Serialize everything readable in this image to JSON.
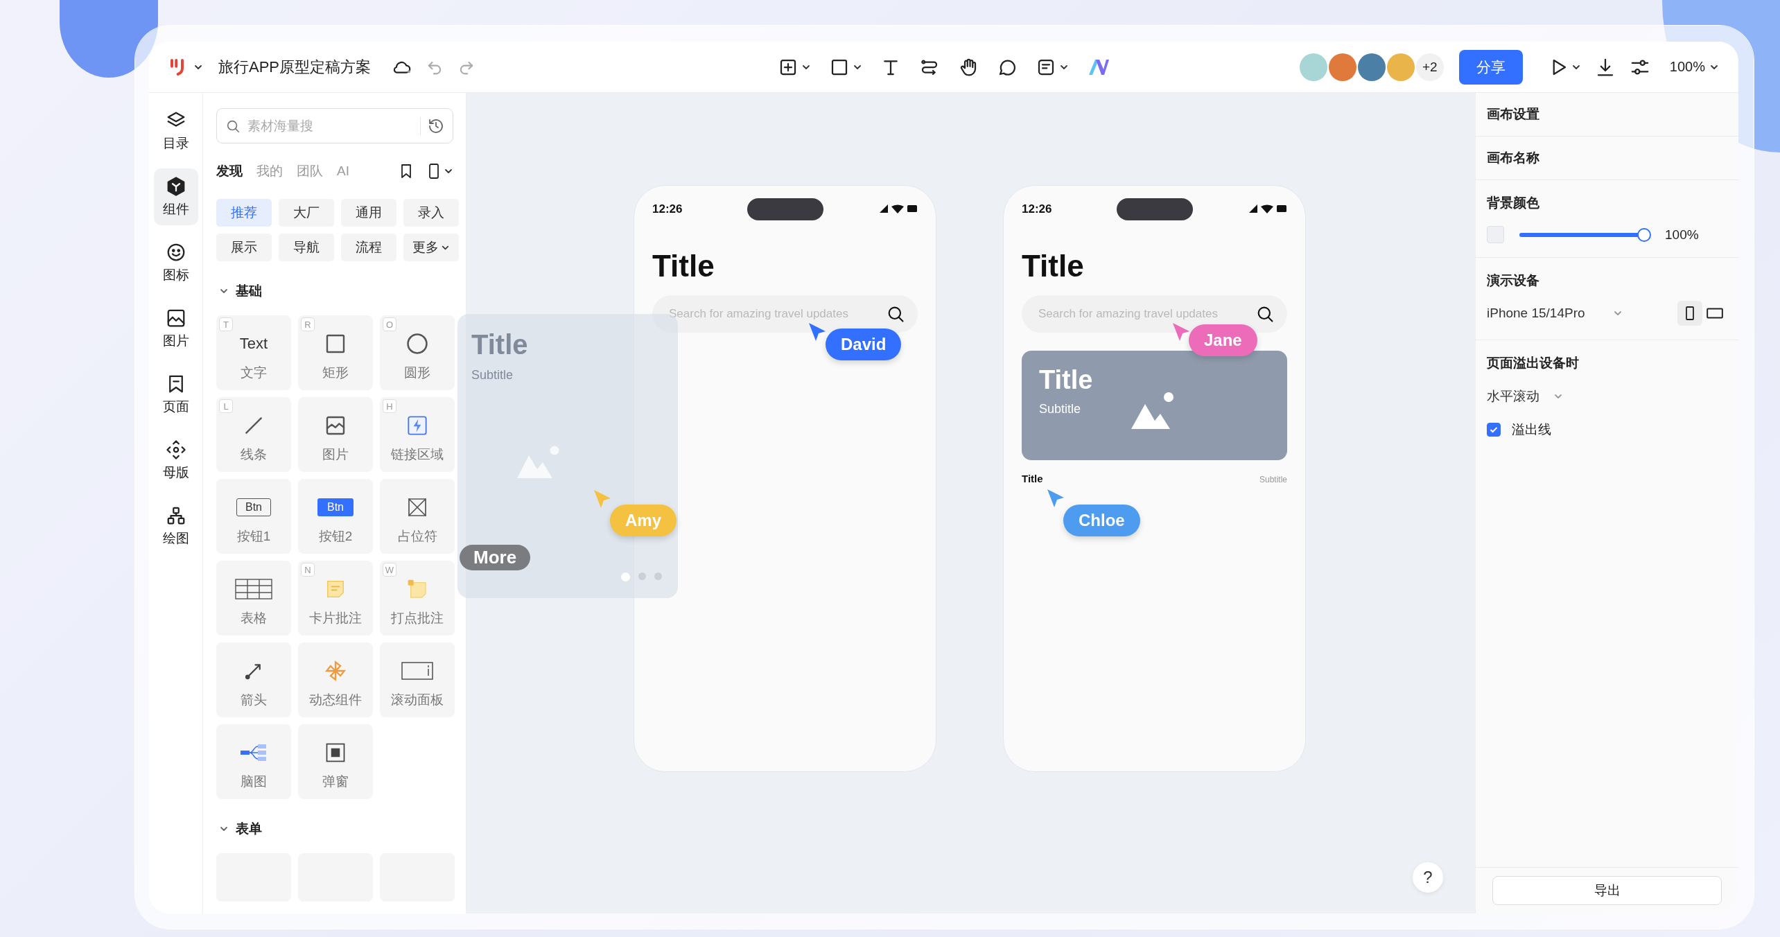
{
  "toolbar": {
    "project_title": "旅行APP原型定稿方案",
    "collaborators_extra": "+2",
    "share_button": "分享",
    "zoom": "100%"
  },
  "rail": [
    {
      "label": "目录",
      "selected": false
    },
    {
      "label": "组件",
      "selected": true
    },
    {
      "label": "图标",
      "selected": false
    },
    {
      "label": "图片",
      "selected": false
    },
    {
      "label": "页面",
      "selected": false
    },
    {
      "label": "母版",
      "selected": false
    },
    {
      "label": "绘图",
      "selected": false
    }
  ],
  "component_panel": {
    "search": {
      "placeholder": "素材海量搜"
    },
    "tabs": [
      {
        "label": "发现",
        "selected": true
      },
      {
        "label": "我的",
        "selected": false
      },
      {
        "label": "团队",
        "selected": false
      },
      {
        "label": "AI",
        "selected": false
      }
    ],
    "categories": [
      {
        "label": "推荐",
        "selected": true,
        "dropdown": false
      },
      {
        "label": "大厂",
        "selected": false,
        "dropdown": false
      },
      {
        "label": "通用",
        "selected": false,
        "dropdown": false
      },
      {
        "label": "录入",
        "selected": false,
        "dropdown": false
      },
      {
        "label": "展示",
        "selected": false,
        "dropdown": false
      },
      {
        "label": "导航",
        "selected": false,
        "dropdown": false
      },
      {
        "label": "流程",
        "selected": false,
        "dropdown": false
      },
      {
        "label": "更多",
        "selected": false,
        "dropdown": true
      }
    ],
    "sections": [
      {
        "title": "基础",
        "expanded": true,
        "items": [
          {
            "kind": "text",
            "label": "文字",
            "shortcut": "T",
            "preview": "Text"
          },
          {
            "kind": "rect",
            "label": "矩形",
            "shortcut": "R"
          },
          {
            "kind": "circle",
            "label": "圆形",
            "shortcut": "O"
          },
          {
            "kind": "line",
            "label": "线条",
            "shortcut": "L"
          },
          {
            "kind": "image",
            "label": "图片"
          },
          {
            "kind": "link",
            "label": "链接区域",
            "shortcut": "H"
          },
          {
            "kind": "button",
            "label": "按钮1",
            "preview": "Btn"
          },
          {
            "kind": "button-filled",
            "label": "按钮2",
            "preview": "Btn"
          },
          {
            "kind": "placeholder",
            "label": "占位符"
          },
          {
            "kind": "table",
            "label": "表格"
          },
          {
            "kind": "card-note",
            "label": "卡片批注",
            "shortcut": "N"
          },
          {
            "kind": "dot-note",
            "label": "打点批注",
            "shortcut": "W"
          },
          {
            "kind": "arrow",
            "label": "箭头"
          },
          {
            "kind": "dynamic",
            "label": "动态组件"
          },
          {
            "kind": "scroll",
            "label": "滚动面板"
          },
          {
            "kind": "mindmap",
            "label": "脑图"
          },
          {
            "kind": "dialog",
            "label": "弹窗"
          }
        ]
      },
      {
        "title": "表单",
        "expanded": true,
        "items": [
          {
            "kind": "blank"
          },
          {
            "kind": "blank"
          },
          {
            "kind": "blank"
          }
        ]
      }
    ]
  },
  "canvas": {
    "phones": [
      {
        "time": "12:26",
        "title": "Title",
        "search": {
          "placeholder": "Search for amazing travel updates"
        }
      },
      {
        "time": "12:26",
        "title": "Title",
        "search": {
          "placeholder": "Search for amazing travel updates"
        },
        "card": {
          "title": "Title",
          "subtitle": "Subtitle"
        },
        "list_row": {
          "title": "Title",
          "subtitle": "Subtitle"
        }
      }
    ],
    "dragged_card": {
      "title": "Title",
      "subtitle": "Subtitle",
      "pager": [
        {
          "selected": true
        },
        {
          "selected": false
        },
        {
          "selected": false
        }
      ]
    },
    "more_label": "More",
    "cursors": [
      {
        "name": "David",
        "color": "#3370ff"
      },
      {
        "name": "Jane",
        "color": "#ec6cb9"
      },
      {
        "name": "Amy",
        "color": "#f4c140"
      },
      {
        "name": "Chloe",
        "color": "#4d9cf0"
      }
    ],
    "help_button": "?"
  },
  "settings": {
    "heading": "画布设置",
    "name_label": "画布名称",
    "background": {
      "label": "背景颜色",
      "level": 1,
      "reading": "100%"
    },
    "device": {
      "label": "演示设备",
      "value": "iPhone 15/14Pro",
      "orientations": [
        {
          "kind": "portrait",
          "selected": true
        },
        {
          "kind": "landscape",
          "selected": false
        }
      ]
    },
    "overflow": {
      "label": "页面溢出设备时",
      "value": "水平滚动",
      "checkbox": {
        "label": "溢出线",
        "checked": true
      }
    },
    "export_button": "导出"
  }
}
